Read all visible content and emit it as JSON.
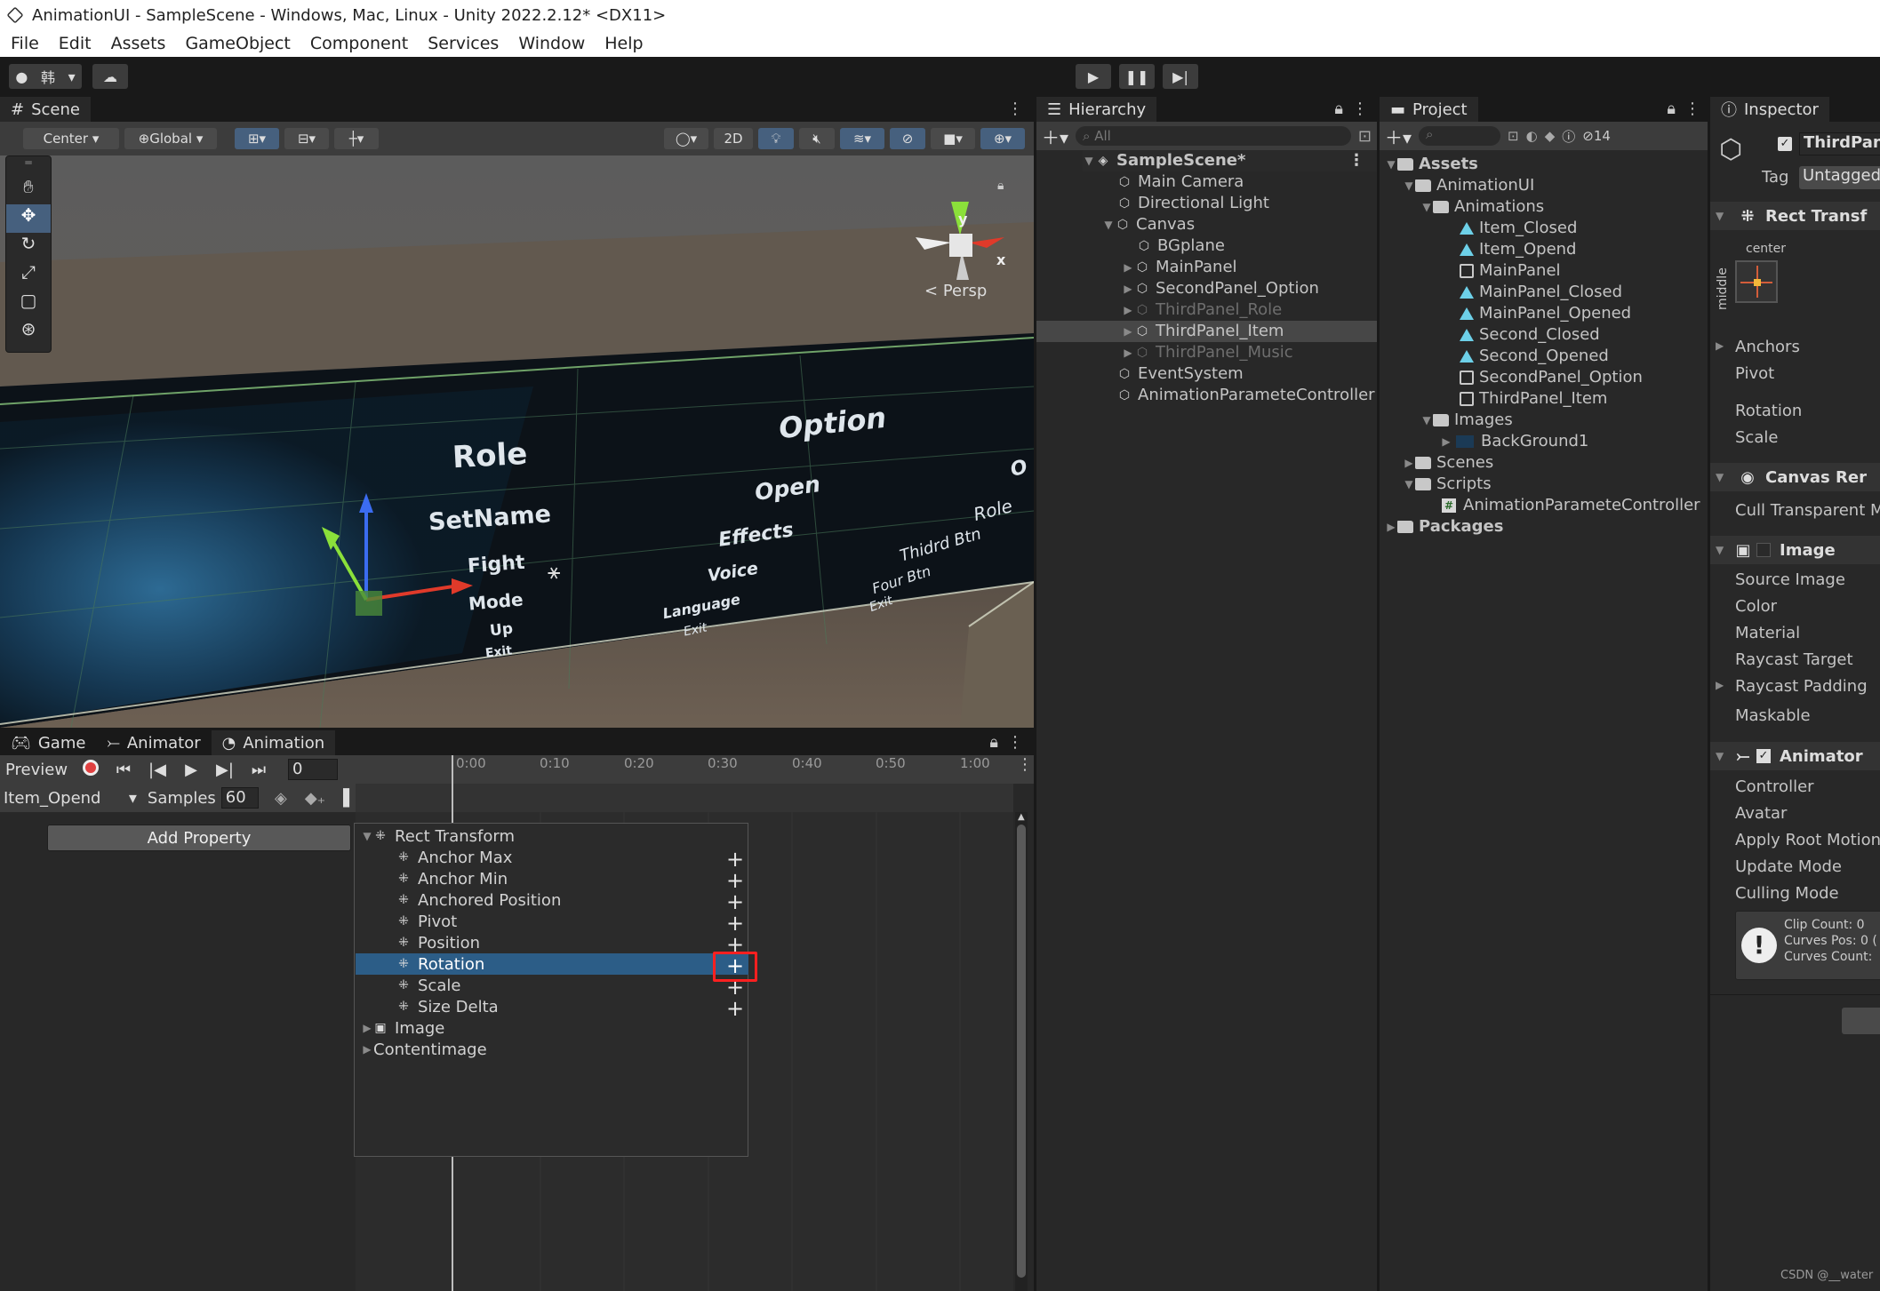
{
  "window_title": "AnimationUI - SampleScene - Windows, Mac, Linux - Unity 2022.2.12* <DX11>",
  "menu": [
    "File",
    "Edit",
    "Assets",
    "GameObject",
    "Component",
    "Services",
    "Window",
    "Help"
  ],
  "account_label": "韩",
  "scene": {
    "tab": "Scene",
    "pivot": "Center",
    "space": "Global",
    "mode_2d": "2D",
    "persp": "Persp",
    "gizmo_y": "y",
    "gizmo_x": "x",
    "ui_texts": [
      "Role",
      "SetName",
      "Fight",
      "Mode",
      "Up",
      "Exit",
      "Option",
      "Open",
      "Effects",
      "Voice",
      "Language",
      "Exit",
      "Role",
      "Thidrd Btn",
      "Four Btn",
      "Exit",
      "O"
    ]
  },
  "hierarchy": {
    "tab": "Hierarchy",
    "search_placeholder": "All",
    "items": [
      {
        "label": "SampleScene*"
      },
      {
        "label": "Main Camera"
      },
      {
        "label": "Directional Light"
      },
      {
        "label": "Canvas"
      },
      {
        "label": "BGplane"
      },
      {
        "label": "MainPanel"
      },
      {
        "label": "SecondPanel_Option"
      },
      {
        "label": "ThirdPanel_Role"
      },
      {
        "label": "ThirdPanel_Item"
      },
      {
        "label": "ThirdPanel_Music"
      },
      {
        "label": "EventSystem"
      },
      {
        "label": "AnimationParameteController"
      }
    ]
  },
  "project": {
    "tab": "Project",
    "hidden_count": "14",
    "items": [
      {
        "label": "Assets"
      },
      {
        "label": "AnimationUI"
      },
      {
        "label": "Animations"
      },
      {
        "label": "Item_Closed"
      },
      {
        "label": "Item_Opend"
      },
      {
        "label": "MainPanel"
      },
      {
        "label": "MainPanel_Closed"
      },
      {
        "label": "MainPanel_Opened"
      },
      {
        "label": "Second_Closed"
      },
      {
        "label": "Second_Opened"
      },
      {
        "label": "SecondPanel_Option"
      },
      {
        "label": "ThirdPanel_Item"
      },
      {
        "label": "Images"
      },
      {
        "label": "BackGround1"
      },
      {
        "label": "Scenes"
      },
      {
        "label": "Scripts"
      },
      {
        "label": "AnimationParameteController"
      },
      {
        "label": "Packages"
      }
    ]
  },
  "inspector": {
    "tab": "Inspector",
    "object_name": "ThirdPane",
    "tag_label": "Tag",
    "tag_value": "Untagged",
    "rect_transform": "Rect Transf",
    "anchor_h": "center",
    "anchor_v": "middle",
    "fields_rt": [
      "Anchors",
      "Pivot",
      "Rotation",
      "Scale"
    ],
    "canvas_renderer": "Canvas Rer",
    "cull": "Cull Transparent M",
    "image": "Image",
    "fields_img": [
      "Source Image",
      "Color",
      "Material",
      "Raycast Target",
      "Raycast Padding",
      "Maskable"
    ],
    "animator": "Animator",
    "fields_anim": [
      "Controller",
      "Avatar",
      "Apply Root Motion",
      "Update Mode",
      "Culling Mode"
    ],
    "info_lines": [
      "Clip Count: 0",
      "Curves Pos: 0 (",
      "Curves Count:"
    ]
  },
  "bottom": {
    "tabs": [
      "Game",
      "Animator",
      "Animation"
    ],
    "preview": "Preview",
    "frame": "0",
    "clip": "Item_Opend",
    "samples_label": "Samples",
    "samples_value": "60",
    "add_property": "Add Property",
    "ticks": [
      "0:00",
      "0:10",
      "0:20",
      "0:30",
      "0:40",
      "0:50",
      "1:00"
    ],
    "tree": [
      {
        "label": "Rect Transform"
      },
      {
        "label": "Anchor Max"
      },
      {
        "label": "Anchor Min"
      },
      {
        "label": "Anchored Position"
      },
      {
        "label": "Pivot"
      },
      {
        "label": "Position"
      },
      {
        "label": "Rotation"
      },
      {
        "label": "Scale"
      },
      {
        "label": "Size Delta"
      },
      {
        "label": "Image"
      },
      {
        "label": "Contentimage"
      }
    ]
  },
  "watermark": "CSDN @__water",
  "colors": {
    "selection": "#2c5d87",
    "highlight_box": "#ff2020",
    "accent_blue": "#4c7ef0"
  }
}
